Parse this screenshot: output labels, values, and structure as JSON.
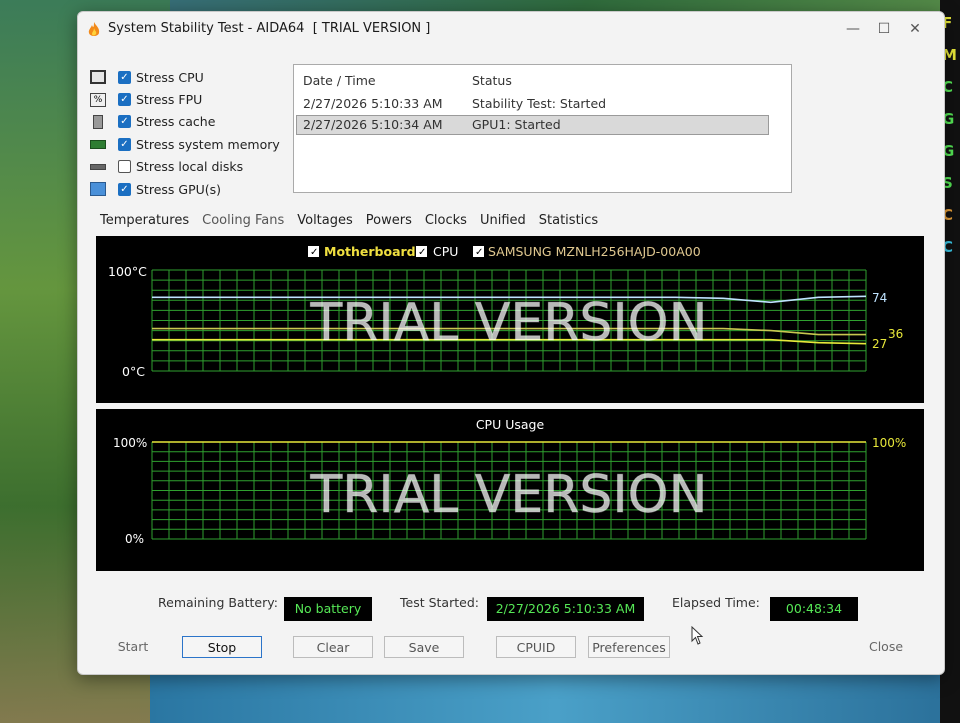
{
  "window": {
    "title": "System Stability Test - AIDA64  [ TRIAL VERSION ]"
  },
  "stress_options": [
    {
      "label": "Stress CPU",
      "checked": true,
      "icon": "cpu-chip-icon"
    },
    {
      "label": "Stress FPU",
      "checked": true,
      "icon": "fpu-chip-icon"
    },
    {
      "label": "Stress cache",
      "checked": true,
      "icon": "cache-icon"
    },
    {
      "label": "Stress system memory",
      "checked": true,
      "icon": "memory-icon"
    },
    {
      "label": "Stress local disks",
      "checked": false,
      "icon": "disk-icon"
    },
    {
      "label": "Stress GPU(s)",
      "checked": true,
      "icon": "gpu-monitor-icon"
    }
  ],
  "log": {
    "columns": [
      "Date / Time",
      "Status"
    ],
    "rows": [
      {
        "datetime": "2/27/2026 5:10:33 AM",
        "status": "Stability Test: Started"
      },
      {
        "datetime": "2/27/2026 5:10:34 AM",
        "status": "GPU1: Started",
        "selected": true
      }
    ]
  },
  "tabs": [
    "Temperatures",
    "Cooling Fans",
    "Voltages",
    "Powers",
    "Clocks",
    "Unified",
    "Statistics"
  ],
  "temp_graph": {
    "legend": [
      "Motherboard",
      "CPU",
      "SAMSUNG MZNLH256HAJD-00A00"
    ],
    "y_max_label": "100°C",
    "y_min_label": "0°C",
    "watermark": "TRIAL VERSION",
    "values": {
      "cpu": "74",
      "motherboard": "27",
      "ssd": "36"
    }
  },
  "cpu_graph": {
    "title": "CPU Usage",
    "y_max_label": "100%",
    "y_min_label": "0%",
    "right_value": "100%",
    "watermark": "TRIAL VERSION"
  },
  "chart_data": [
    {
      "type": "line",
      "title": "",
      "ylabel": "",
      "ylim": [
        0,
        100
      ],
      "series": [
        {
          "name": "CPU",
          "color": "#bfe3ff",
          "values": [
            73,
            73,
            73,
            73,
            73,
            73,
            73,
            73,
            73,
            73,
            73,
            73,
            72,
            68,
            73,
            74
          ]
        },
        {
          "name": "SAMSUNG MZNLH256HAJD-00A00",
          "color": "#c8c850",
          "values": [
            42,
            42,
            42,
            42,
            42,
            42,
            42,
            42,
            42,
            42,
            42,
            42,
            42,
            40,
            36,
            36
          ]
        },
        {
          "name": "Motherboard",
          "color": "#e8e83a",
          "values": [
            31,
            31,
            31,
            31,
            31,
            31,
            31,
            31,
            31,
            31,
            31,
            31,
            31,
            31,
            28,
            27
          ]
        }
      ]
    },
    {
      "type": "line",
      "title": "CPU Usage",
      "ylim": [
        0,
        100
      ],
      "series": [
        {
          "name": "",
          "color": "#e8e83a",
          "values": [
            100,
            100,
            100,
            100,
            100,
            100,
            100,
            100,
            100,
            100,
            100,
            100,
            100,
            100,
            100,
            100
          ]
        }
      ]
    }
  ],
  "status": {
    "battery_label": "Remaining Battery:",
    "battery_value": "No battery",
    "started_label": "Test Started:",
    "started_value": "2/27/2026 5:10:33 AM",
    "elapsed_label": "Elapsed Time:",
    "elapsed_value": "00:48:34"
  },
  "buttons": {
    "start": "Start",
    "stop": "Stop",
    "clear": "Clear",
    "save": "Save",
    "cpuid": "CPUID",
    "preferences": "Preferences",
    "close": "Close"
  },
  "colors": {
    "grid": "#2fa02f",
    "lcd_text": "#56e856",
    "accent": "#1b6fc2"
  }
}
